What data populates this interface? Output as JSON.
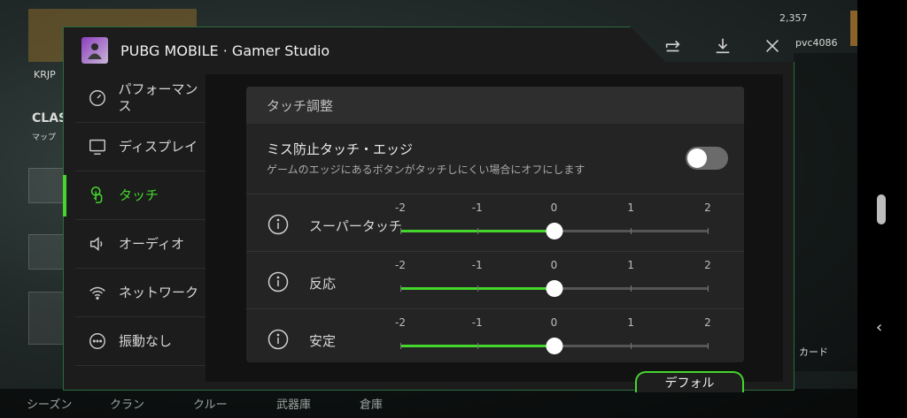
{
  "background": {
    "hud_score": "2,357",
    "player_tag": "pvc4086",
    "left_text_1": "KRJP",
    "left_text_2": "CLASS",
    "left_text_3": "マップ",
    "right_text": "カード",
    "bottom_tabs": [
      "シーズン",
      "クラン",
      "クルー",
      "武器庫",
      "倉庫"
    ]
  },
  "panel": {
    "app_title": "PUBG MOBILE · Gamer Studio",
    "top_icons": [
      "share-icon",
      "download-icon",
      "close-icon"
    ]
  },
  "sidebar": {
    "items": [
      {
        "label": "パフォーマンス",
        "icon": "speedometer-icon",
        "active": false
      },
      {
        "label": "ディスプレイ",
        "icon": "monitor-icon",
        "active": false
      },
      {
        "label": "タッチ",
        "icon": "touch-icon",
        "active": true
      },
      {
        "label": "オーディオ",
        "icon": "speaker-icon",
        "active": false
      },
      {
        "label": "ネットワーク",
        "icon": "wifi-icon",
        "active": false
      },
      {
        "label": "振動なし",
        "icon": "more-icon",
        "active": false
      }
    ]
  },
  "touch": {
    "header": "タッチ調整",
    "edge": {
      "title": "ミス防止タッチ・エッジ",
      "description": "ゲームのエッジにあるボタンがタッチしにくい場合にオフにします",
      "enabled": false
    },
    "sliders": [
      {
        "label": "スーパータッチ",
        "value": 0
      },
      {
        "label": "反応",
        "value": 0
      },
      {
        "label": "安定",
        "value": 0
      }
    ],
    "ticks": [
      "-2",
      "-1",
      "0",
      "1",
      "2"
    ],
    "min": -2,
    "max": 2
  },
  "default_button": "デフォル",
  "colors": {
    "accent": "#44d62c",
    "panel": "#1c1c1c",
    "card": "#242424"
  }
}
